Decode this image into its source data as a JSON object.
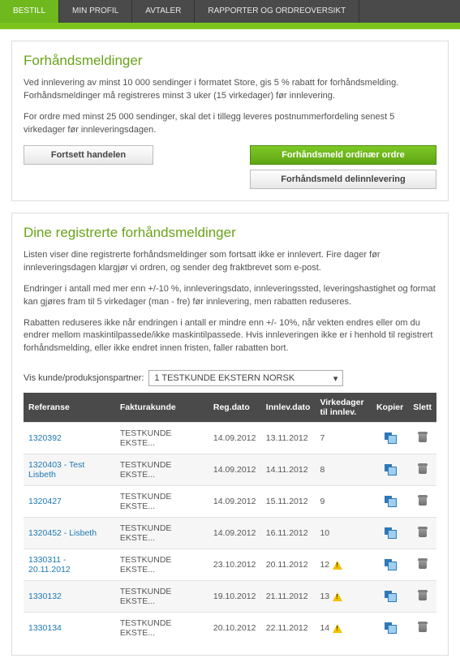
{
  "nav": {
    "items": [
      {
        "label": "BESTILL",
        "active": true
      },
      {
        "label": "MIN PROFIL",
        "active": false
      },
      {
        "label": "AVTALER",
        "active": false
      },
      {
        "label": "RAPPORTER OG ORDREOVERSIKT",
        "active": false
      }
    ]
  },
  "panel1": {
    "title": "Forhåndsmeldinger",
    "p1": "Ved innlevering av minst 10 000 sendinger i formatet Store, gis 5 % rabatt for forhåndsmelding. Forhåndsmeldinger må registreres minst 3 uker (15 virkedager) før innlevering.",
    "p2": "For ordre med minst 25 000 sendinger, skal det i tillegg leveres postnummerfordeling senest 5 virkedager før innleveringsdagen.",
    "btn_continue": "Fortsett handelen",
    "btn_ordinary": "Forhåndsmeld ordinær ordre",
    "btn_partial": "Forhåndsmeld delinnlevering"
  },
  "panel2": {
    "title": "Dine registrerte forhåndsmeldinger",
    "p1": "Listen viser dine registrerte forhåndsmeldinger som fortsatt ikke er innlevert. Fire dager før innleveringsdagen klargjør vi ordren, og sender deg fraktbrevet som e-post.",
    "p2": "Endringer i antall med mer enn +/-10 %, innleveringsdato, innleveringssted, leveringshastighet og format kan gjøres fram til 5 virkedager (man - fre) før innlevering, men rabatten reduseres.",
    "p3": "Rabatten reduseres ikke når endringen i antall er mindre enn +/- 10%, når vekten endres eller om du endrer mellom maskintilpassede/ikke maskintilpassede. Hvis innleveringen ikke er i henhold til registrert forhåndsmelding, eller ikke endret innen fristen, faller rabatten bort.",
    "partner_label": "Vis kunde/produksjonspartner:",
    "partner_selected": "1 TESTKUNDE EKSTERN NORSK"
  },
  "table": {
    "headers": {
      "ref": "Referanse",
      "fk": "Fakturakunde",
      "regdato": "Reg.dato",
      "innlevdato": "Innlev.dato",
      "virkedager": "Virkedager til innlev.",
      "kopier": "Kopier",
      "slett": "Slett"
    },
    "rows": [
      {
        "ref": "1320392",
        "fk": "TESTKUNDE EKSTE...",
        "reg": "14.09.2012",
        "inn": "13.11.2012",
        "vd": "7",
        "warn": false
      },
      {
        "ref": "1320403 - Test Lisbeth",
        "fk": "TESTKUNDE EKSTE...",
        "reg": "14.09.2012",
        "inn": "14.11.2012",
        "vd": "8",
        "warn": false
      },
      {
        "ref": "1320427",
        "fk": "TESTKUNDE EKSTE...",
        "reg": "14.09.2012",
        "inn": "15.11.2012",
        "vd": "9",
        "warn": false
      },
      {
        "ref": "1320452 - Lisbeth",
        "fk": "TESTKUNDE EKSTE...",
        "reg": "14.09.2012",
        "inn": "16.11.2012",
        "vd": "10",
        "warn": false
      },
      {
        "ref": "1330311 - 20.11.2012",
        "fk": "TESTKUNDE EKSTE...",
        "reg": "23.10.2012",
        "inn": "20.11.2012",
        "vd": "12",
        "warn": true
      },
      {
        "ref": "1330132",
        "fk": "TESTKUNDE EKSTE...",
        "reg": "19.10.2012",
        "inn": "21.11.2012",
        "vd": "13",
        "warn": true
      },
      {
        "ref": "1330134",
        "fk": "TESTKUNDE EKSTE...",
        "reg": "20.10.2012",
        "inn": "22.11.2012",
        "vd": "14",
        "warn": true
      }
    ]
  }
}
